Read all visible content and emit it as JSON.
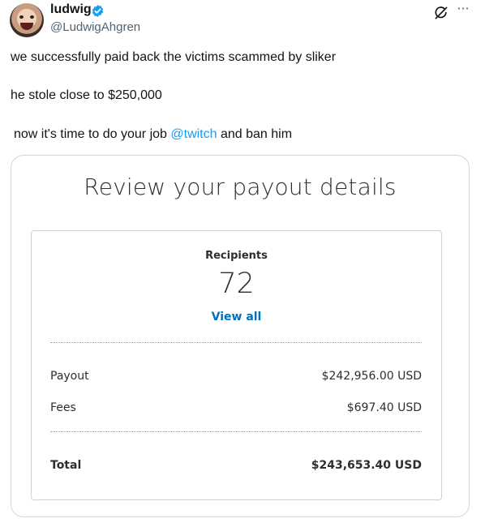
{
  "author": {
    "name": "ludwig",
    "handle": "@LudwigAhgren",
    "avatar_icon": "avatar",
    "verified_icon": "verified-badge-icon",
    "verified_color": "#1d9bf0"
  },
  "header_actions": {
    "grok_icon": "grok-icon",
    "more_icon": "more-icon",
    "more_glyph": "···"
  },
  "tweet": {
    "line1": "we successfully paid back the victims scammed by sliker",
    "line2": "he stole close to $250,000",
    "line3_before": "now it's time to do your job ",
    "line3_mention": "@twitch",
    "line3_after": " and ban him",
    "mention_color": "#1d9bf0"
  },
  "media": {
    "title": "Review your payout details",
    "recipients_label": "Recipients",
    "recipients_count": "72",
    "view_all": "View all",
    "link_color": "#0070ba",
    "rows": [
      {
        "label": "Payout",
        "value": "$242,956.00 USD"
      },
      {
        "label": "Fees",
        "value": "$697.40 USD"
      },
      {
        "label": "Total",
        "value": "$243,653.40 USD"
      }
    ]
  }
}
